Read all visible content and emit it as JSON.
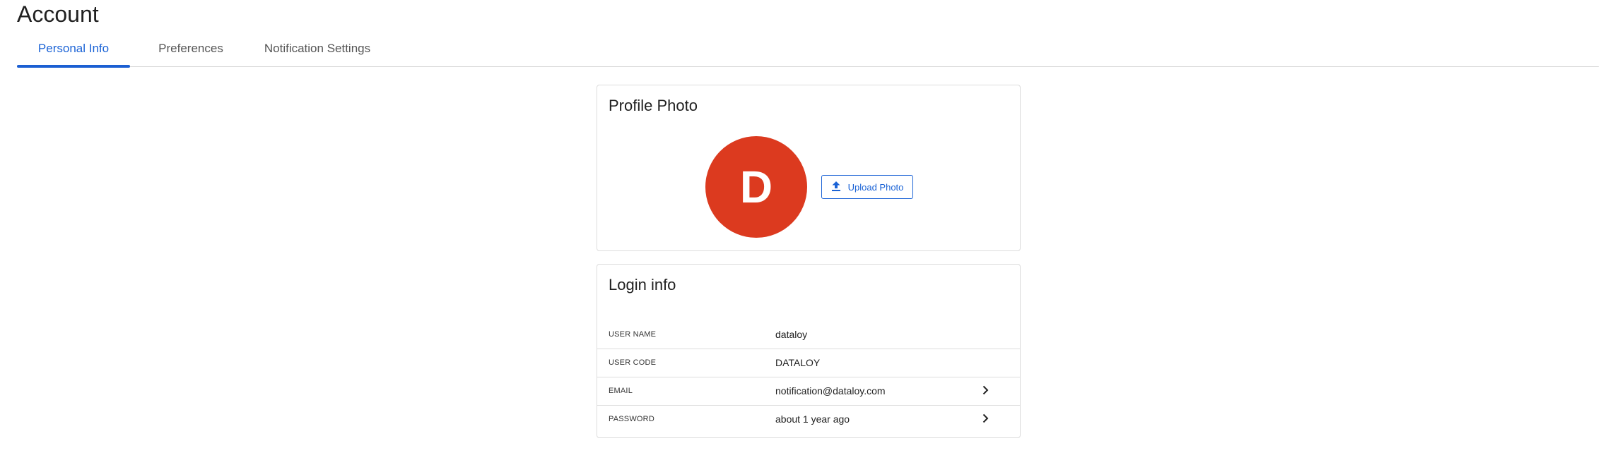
{
  "page": {
    "title": "Account"
  },
  "tabs": [
    {
      "label": "Personal Info",
      "active": true
    },
    {
      "label": "Preferences",
      "active": false
    },
    {
      "label": "Notification Settings",
      "active": false
    }
  ],
  "profile_photo": {
    "title": "Profile Photo",
    "avatar_initial": "D",
    "avatar_color": "#dc3a1f",
    "upload_label": "Upload Photo",
    "upload_icon": "upload-icon"
  },
  "login_info": {
    "title": "Login info",
    "rows": [
      {
        "label": "USER NAME",
        "value": "dataloy",
        "has_chevron": false
      },
      {
        "label": "USER CODE",
        "value": "DATALOY",
        "has_chevron": false
      },
      {
        "label": "EMAIL",
        "value": "notification@dataloy.com",
        "has_chevron": true
      },
      {
        "label": "PASSWORD",
        "value": "about 1 year ago",
        "has_chevron": true
      }
    ]
  },
  "colors": {
    "accent": "#1b63d6",
    "border": "#dcdcdc"
  }
}
